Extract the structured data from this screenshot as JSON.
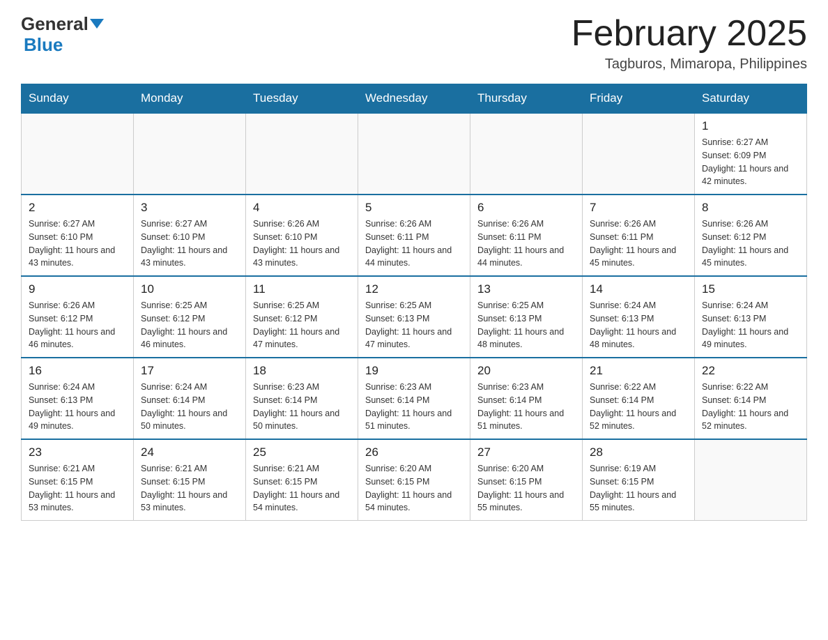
{
  "header": {
    "logo_line1": "General",
    "logo_line2": "Blue",
    "month_title": "February 2025",
    "location": "Tagburos, Mimaropa, Philippines"
  },
  "days_of_week": [
    "Sunday",
    "Monday",
    "Tuesday",
    "Wednesday",
    "Thursday",
    "Friday",
    "Saturday"
  ],
  "weeks": [
    [
      {
        "day": "",
        "info": ""
      },
      {
        "day": "",
        "info": ""
      },
      {
        "day": "",
        "info": ""
      },
      {
        "day": "",
        "info": ""
      },
      {
        "day": "",
        "info": ""
      },
      {
        "day": "",
        "info": ""
      },
      {
        "day": "1",
        "info": "Sunrise: 6:27 AM\nSunset: 6:09 PM\nDaylight: 11 hours and 42 minutes."
      }
    ],
    [
      {
        "day": "2",
        "info": "Sunrise: 6:27 AM\nSunset: 6:10 PM\nDaylight: 11 hours and 43 minutes."
      },
      {
        "day": "3",
        "info": "Sunrise: 6:27 AM\nSunset: 6:10 PM\nDaylight: 11 hours and 43 minutes."
      },
      {
        "day": "4",
        "info": "Sunrise: 6:26 AM\nSunset: 6:10 PM\nDaylight: 11 hours and 43 minutes."
      },
      {
        "day": "5",
        "info": "Sunrise: 6:26 AM\nSunset: 6:11 PM\nDaylight: 11 hours and 44 minutes."
      },
      {
        "day": "6",
        "info": "Sunrise: 6:26 AM\nSunset: 6:11 PM\nDaylight: 11 hours and 44 minutes."
      },
      {
        "day": "7",
        "info": "Sunrise: 6:26 AM\nSunset: 6:11 PM\nDaylight: 11 hours and 45 minutes."
      },
      {
        "day": "8",
        "info": "Sunrise: 6:26 AM\nSunset: 6:12 PM\nDaylight: 11 hours and 45 minutes."
      }
    ],
    [
      {
        "day": "9",
        "info": "Sunrise: 6:26 AM\nSunset: 6:12 PM\nDaylight: 11 hours and 46 minutes."
      },
      {
        "day": "10",
        "info": "Sunrise: 6:25 AM\nSunset: 6:12 PM\nDaylight: 11 hours and 46 minutes."
      },
      {
        "day": "11",
        "info": "Sunrise: 6:25 AM\nSunset: 6:12 PM\nDaylight: 11 hours and 47 minutes."
      },
      {
        "day": "12",
        "info": "Sunrise: 6:25 AM\nSunset: 6:13 PM\nDaylight: 11 hours and 47 minutes."
      },
      {
        "day": "13",
        "info": "Sunrise: 6:25 AM\nSunset: 6:13 PM\nDaylight: 11 hours and 48 minutes."
      },
      {
        "day": "14",
        "info": "Sunrise: 6:24 AM\nSunset: 6:13 PM\nDaylight: 11 hours and 48 minutes."
      },
      {
        "day": "15",
        "info": "Sunrise: 6:24 AM\nSunset: 6:13 PM\nDaylight: 11 hours and 49 minutes."
      }
    ],
    [
      {
        "day": "16",
        "info": "Sunrise: 6:24 AM\nSunset: 6:13 PM\nDaylight: 11 hours and 49 minutes."
      },
      {
        "day": "17",
        "info": "Sunrise: 6:24 AM\nSunset: 6:14 PM\nDaylight: 11 hours and 50 minutes."
      },
      {
        "day": "18",
        "info": "Sunrise: 6:23 AM\nSunset: 6:14 PM\nDaylight: 11 hours and 50 minutes."
      },
      {
        "day": "19",
        "info": "Sunrise: 6:23 AM\nSunset: 6:14 PM\nDaylight: 11 hours and 51 minutes."
      },
      {
        "day": "20",
        "info": "Sunrise: 6:23 AM\nSunset: 6:14 PM\nDaylight: 11 hours and 51 minutes."
      },
      {
        "day": "21",
        "info": "Sunrise: 6:22 AM\nSunset: 6:14 PM\nDaylight: 11 hours and 52 minutes."
      },
      {
        "day": "22",
        "info": "Sunrise: 6:22 AM\nSunset: 6:14 PM\nDaylight: 11 hours and 52 minutes."
      }
    ],
    [
      {
        "day": "23",
        "info": "Sunrise: 6:21 AM\nSunset: 6:15 PM\nDaylight: 11 hours and 53 minutes."
      },
      {
        "day": "24",
        "info": "Sunrise: 6:21 AM\nSunset: 6:15 PM\nDaylight: 11 hours and 53 minutes."
      },
      {
        "day": "25",
        "info": "Sunrise: 6:21 AM\nSunset: 6:15 PM\nDaylight: 11 hours and 54 minutes."
      },
      {
        "day": "26",
        "info": "Sunrise: 6:20 AM\nSunset: 6:15 PM\nDaylight: 11 hours and 54 minutes."
      },
      {
        "day": "27",
        "info": "Sunrise: 6:20 AM\nSunset: 6:15 PM\nDaylight: 11 hours and 55 minutes."
      },
      {
        "day": "28",
        "info": "Sunrise: 6:19 AM\nSunset: 6:15 PM\nDaylight: 11 hours and 55 minutes."
      },
      {
        "day": "",
        "info": ""
      }
    ]
  ]
}
